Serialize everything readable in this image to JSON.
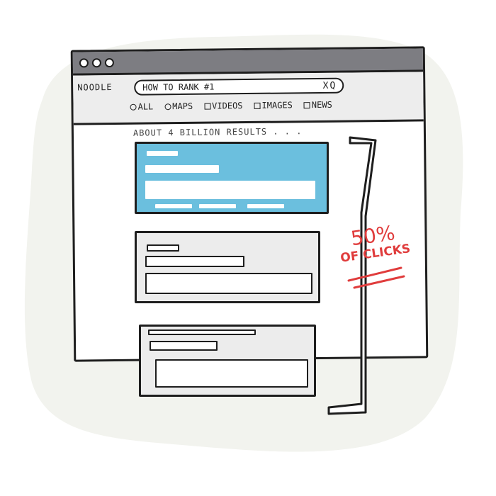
{
  "browser": {
    "logo": "NOODLE",
    "search": {
      "query": "HOW TO RANK #1",
      "clear_glyph": "X",
      "search_glyph": "Q"
    },
    "tabs": [
      {
        "icon": "radio-icon",
        "label": "ALL"
      },
      {
        "icon": "map-pin-icon",
        "label": "MAPS"
      },
      {
        "icon": "video-icon",
        "label": "VIDEOS"
      },
      {
        "icon": "image-icon",
        "label": "IMAGES"
      },
      {
        "icon": "news-icon",
        "label": "NEWS"
      }
    ],
    "results_count": "ABOUT 4 BILLION RESULTS . . ."
  },
  "annotation": {
    "percent": "50%",
    "caption": "OF CLICKS",
    "color": "#e03c3c"
  },
  "colors": {
    "highlight": "#6bbfde",
    "titlebar": "#7d7d82",
    "panel": "#ececec",
    "backdrop": "#f2f3ee"
  }
}
